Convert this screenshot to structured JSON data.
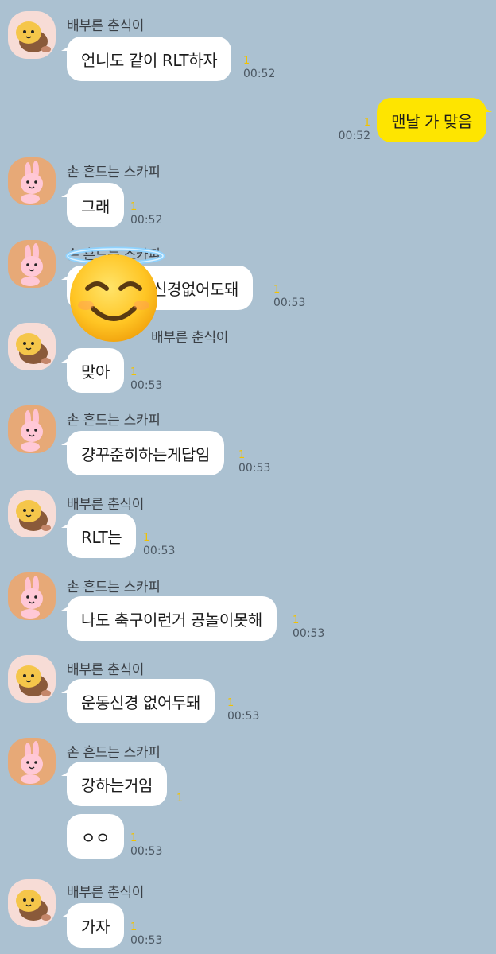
{
  "messages": [
    {
      "sender": "배부른 춘식이",
      "text": "언니도 같이 RLT하자",
      "unread": "1",
      "time": "00:52"
    },
    {
      "text": "맨날 가 맞음",
      "unread": "1",
      "time": "00:52"
    },
    {
      "sender": "손 흔드는 스카피",
      "text": "그래",
      "unread": "1",
      "time": "00:52"
    },
    {
      "sender": "손 흔드는 스카피",
      "text": "신경없어도돼",
      "unread": "1",
      "time": "00:53"
    },
    {
      "sender": "배부른 춘식이",
      "text": "맞아",
      "unread": "1",
      "time": "00:53"
    },
    {
      "sender": "손 흔드는 스카피",
      "text": "걍꾸준히하는게답임",
      "unread": "1",
      "time": "00:53"
    },
    {
      "sender": "배부른 춘식이",
      "text": "RLT는",
      "unread": "1",
      "time": "00:53"
    },
    {
      "sender": "손 흔드는 스카피",
      "text": "나도 축구이런거 공놀이못해",
      "unread": "1",
      "time": "00:53"
    },
    {
      "sender": "배부른 춘식이",
      "text": "운동신경 없어두돼",
      "unread": "1",
      "time": "00:53"
    },
    {
      "sender": "손 흔드는 스카피",
      "text": "강하는거임",
      "unread": "1"
    },
    {
      "text": "ㅇㅇ",
      "unread": "1",
      "time": "00:53"
    },
    {
      "sender": "배부른 춘식이",
      "text": "가자",
      "unread": "1",
      "time": "00:53"
    }
  ],
  "icons": {
    "chunsik": "chunsik-avatar-icon",
    "scappy": "scappy-avatar-icon",
    "censor": "halo-smiling-face-emoji"
  },
  "colors": {
    "background": "#abc1d1",
    "my_bubble": "#fee500",
    "other_bubble": "#ffffff",
    "unread": "#f2c200"
  }
}
